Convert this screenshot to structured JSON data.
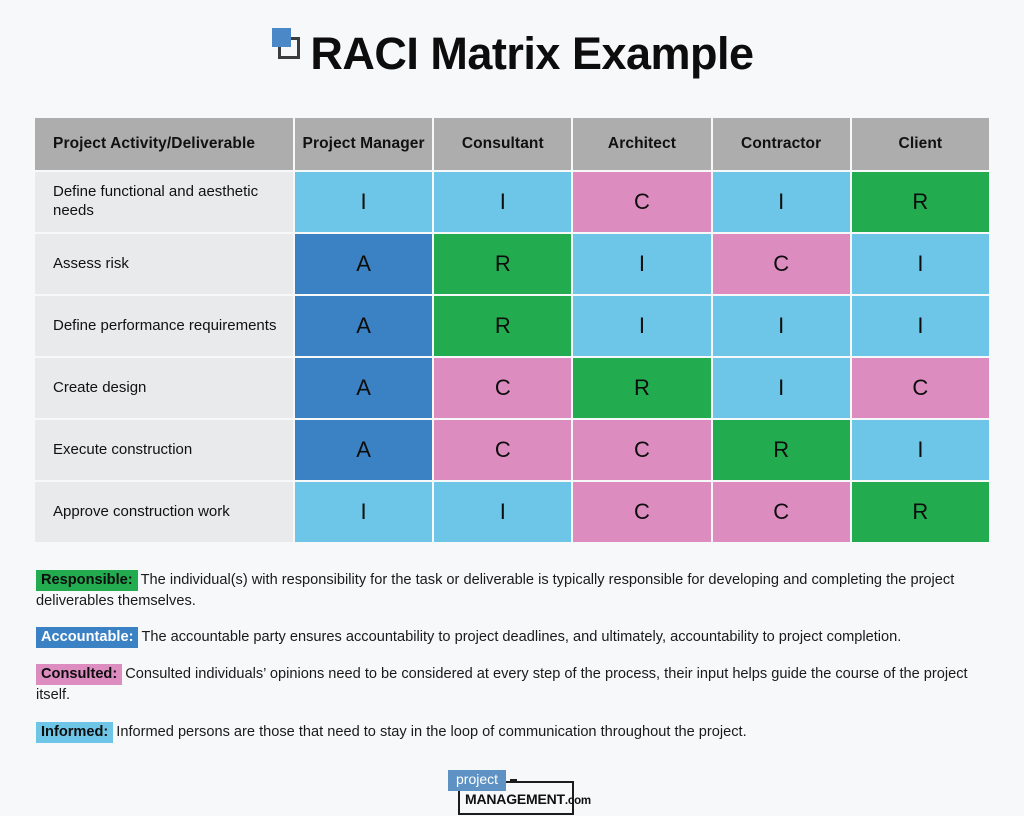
{
  "header": {
    "title": "RACI Matrix Example",
    "logo_icon": "overlapping-squares-icon"
  },
  "colors": {
    "responsible": "#22ac4f",
    "accountable": "#3b82c4",
    "consulted": "#dd8cc0",
    "informed": "#6dc6e8",
    "header_gray": "#adadad",
    "row_label_gray": "#e8eaec",
    "page_background": "#f7f8fa"
  },
  "matrix": {
    "columns": [
      "Project Activity/Deliverable",
      "Project Manager",
      "Consultant",
      "Architect",
      "Contractor",
      "Client"
    ],
    "rows": [
      {
        "activity": "Define functional and aesthetic needs",
        "cells": [
          "I",
          "I",
          "C",
          "I",
          "R"
        ]
      },
      {
        "activity": "Assess risk",
        "cells": [
          "A",
          "R",
          "I",
          "C",
          "I"
        ]
      },
      {
        "activity": "Define performance requirements",
        "cells": [
          "A",
          "R",
          "I",
          "I",
          "I"
        ]
      },
      {
        "activity": "Create design",
        "cells": [
          "A",
          "C",
          "R",
          "I",
          "C"
        ]
      },
      {
        "activity": "Execute construction",
        "cells": [
          "A",
          "C",
          "C",
          "R",
          "I"
        ]
      },
      {
        "activity": "Approve construction work",
        "cells": [
          "I",
          "I",
          "C",
          "C",
          "R"
        ]
      }
    ]
  },
  "legend": [
    {
      "badge": "Responsible:",
      "code": "r",
      "text": "The individual(s) with responsibility for the task or deliverable is typically responsible for developing and completing the project deliverables themselves."
    },
    {
      "badge": "Accountable:",
      "code": "a",
      "text": "The accountable party ensures accountability to project deadlines, and ultimately, accountability to project completion."
    },
    {
      "badge": "Consulted:",
      "code": "c",
      "text": "Consulted individuals’ opinions need to be considered at every step of the process, their input helps guide the course of the project itself."
    },
    {
      "badge": "Informed:",
      "code": "i",
      "text": "Informed persons are those that need to stay in the loop of communication throughout the project."
    }
  ],
  "footer": {
    "logo_word_1": "project",
    "logo_word_2": "MANAGEMENT",
    "logo_suffix": ".com"
  }
}
